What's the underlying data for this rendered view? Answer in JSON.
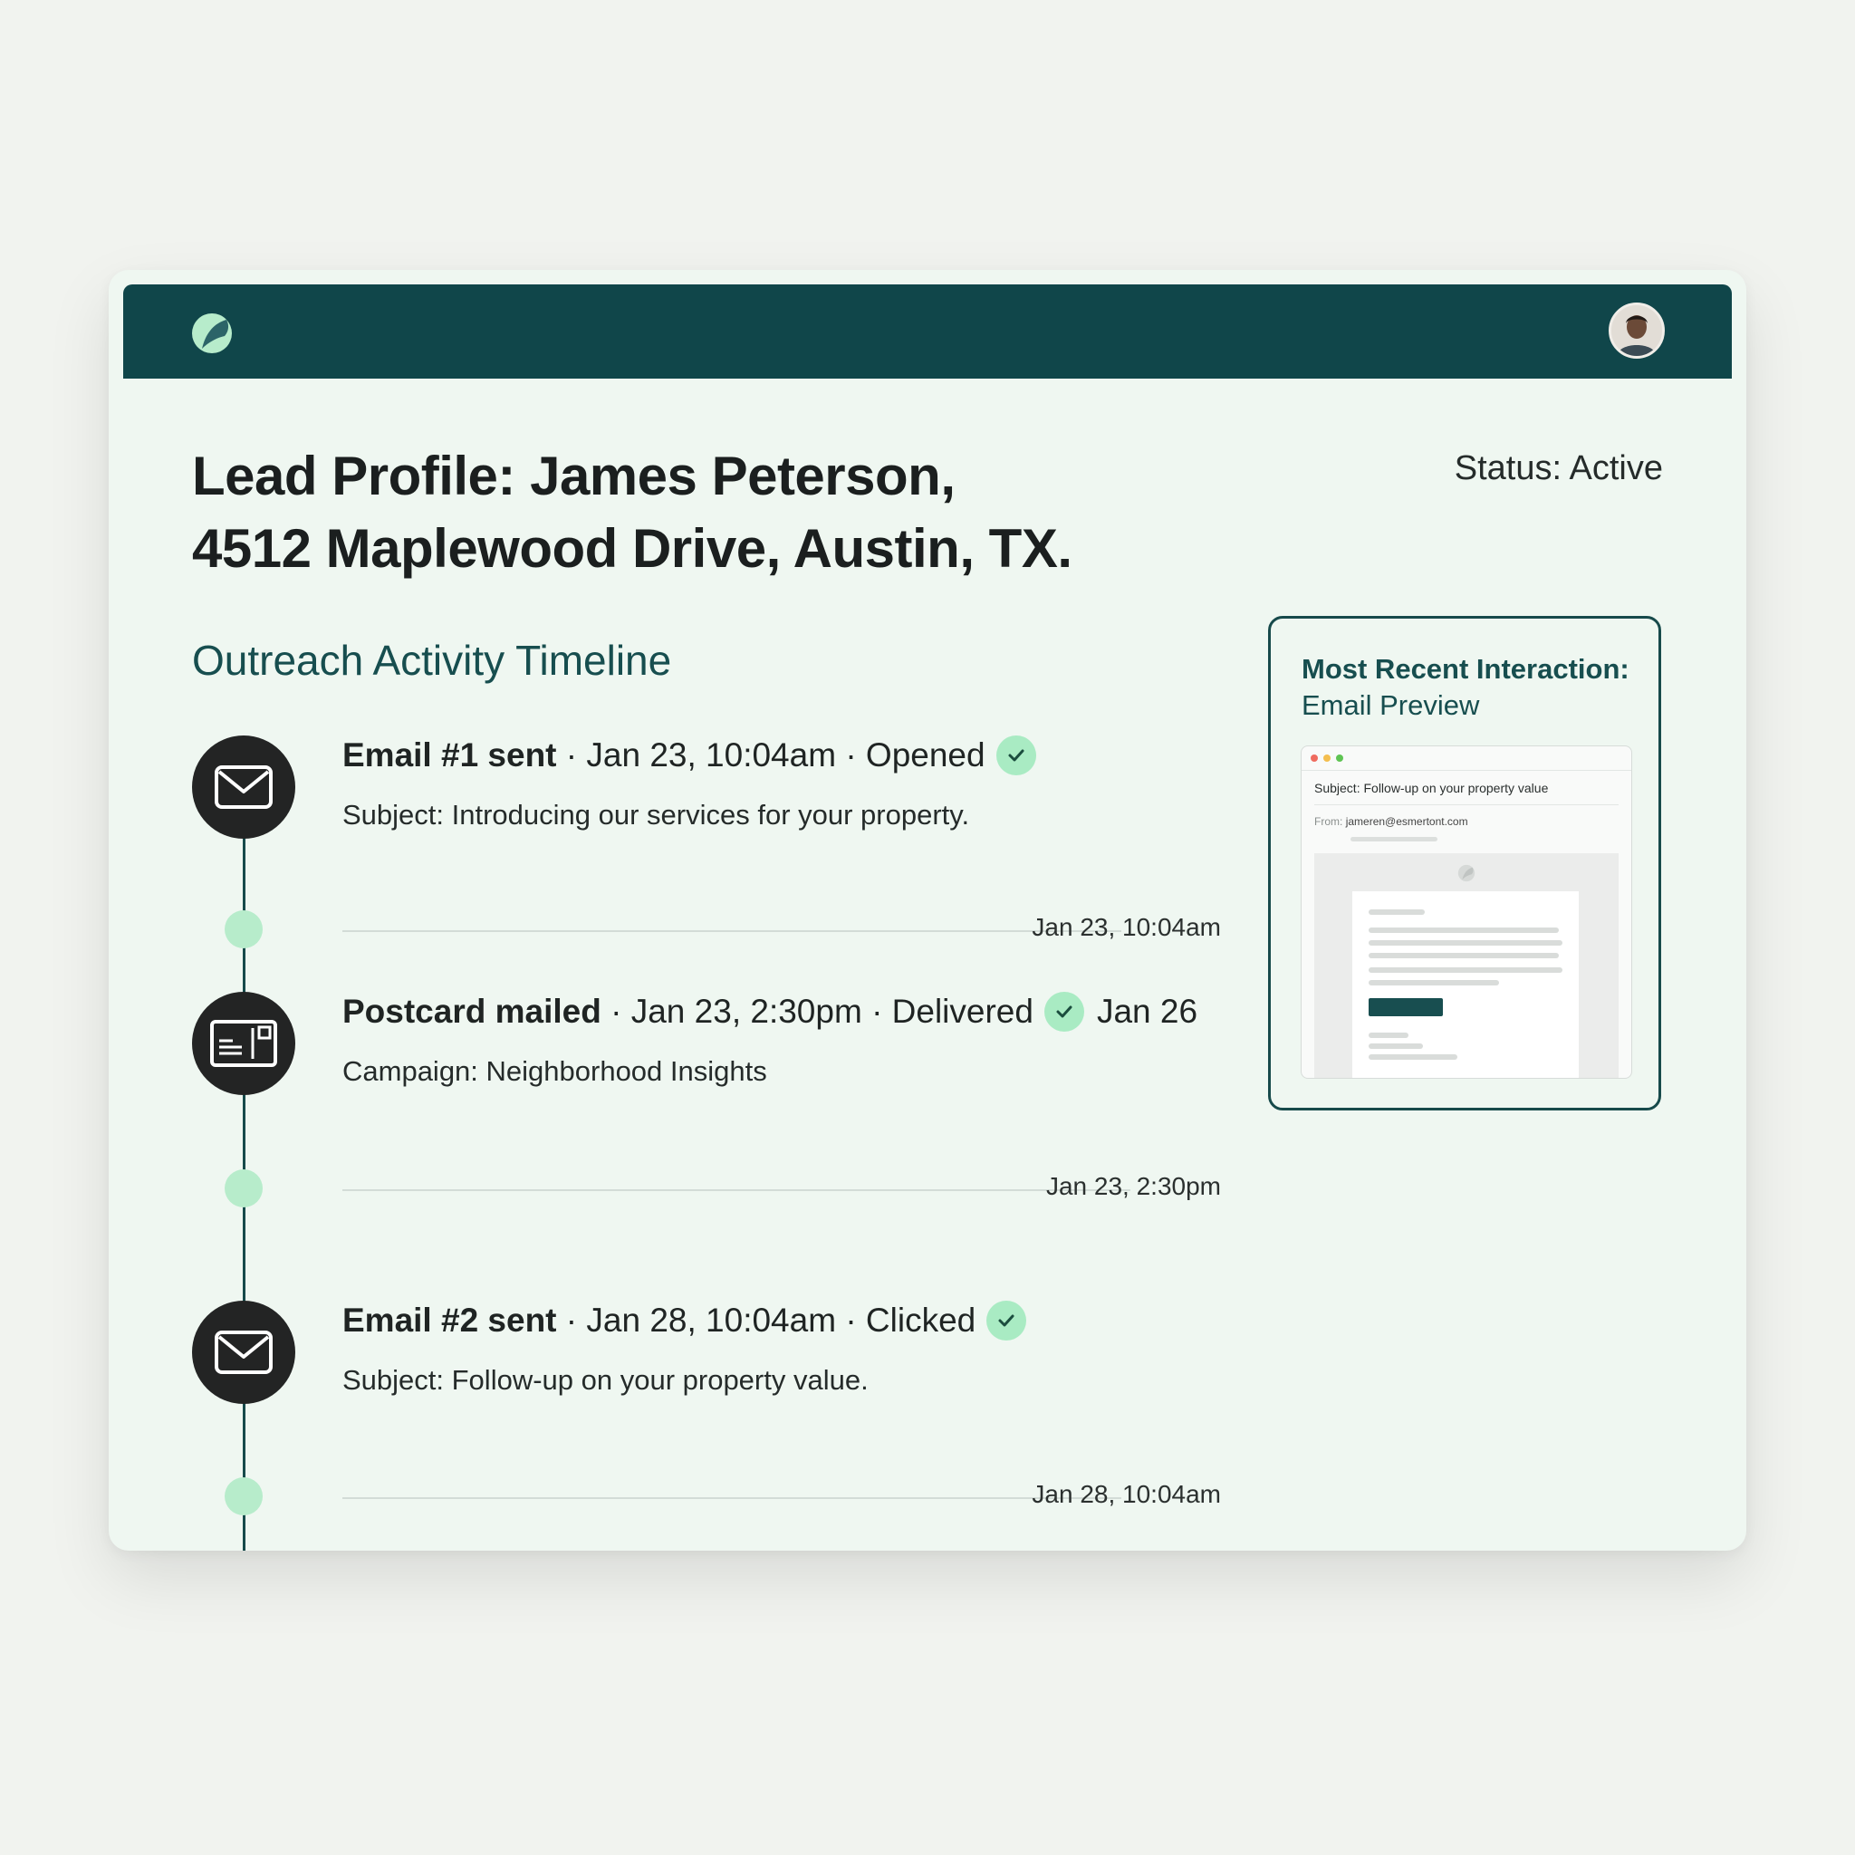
{
  "header": {
    "logo_icon": "leaf-logo-icon",
    "avatar_icon": "user-avatar",
    "bar_color": "#10464a"
  },
  "profile": {
    "title_line1": "Lead Profile: James Peterson,",
    "title_line2": "4512 Maplewood Drive, Austin, TX.",
    "status": "Status: Active"
  },
  "timeline": {
    "title": "Outreach Activity Timeline",
    "events": [
      {
        "icon": "envelope-icon",
        "label": "Email #1 sent",
        "rest": " · Jan 23, 10:04am · Opened",
        "after_check": "",
        "sub": "Subject: Introducing our services for your property.",
        "timestamp": "Jan 23, 10:04am"
      },
      {
        "icon": "postcard-icon",
        "label": "Postcard mailed",
        "rest": " · Jan 23, 2:30pm · Delivered",
        "after_check": "Jan 26",
        "sub": "Campaign: Neighborhood Insights",
        "timestamp": "Jan 23, 2:30pm"
      },
      {
        "icon": "envelope-icon",
        "label": "Email #2 sent",
        "rest": " · Jan 28, 10:04am · Clicked",
        "after_check": "",
        "sub": "Subject: Follow-up on your property value.",
        "timestamp": "Jan 28, 10:04am"
      }
    ]
  },
  "preview": {
    "title": "Most Recent Interaction:",
    "subtitle": "Email Preview",
    "email_subject": "Subject: Follow-up on your property value",
    "from_label": "From:",
    "from_address": "jameren@esmertont.com"
  },
  "colors": {
    "accent_dark": "#10464a",
    "accent_mint": "#b7eccb",
    "check_bg": "#a9ebc3"
  }
}
